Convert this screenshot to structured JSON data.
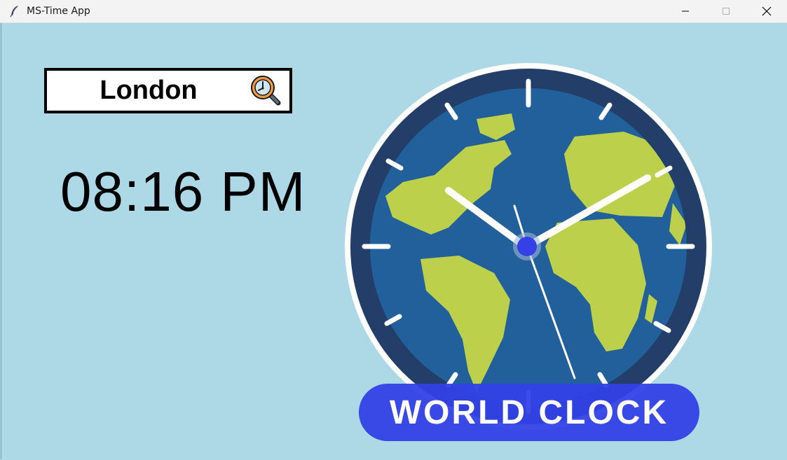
{
  "window": {
    "title": "MS-Time App",
    "controls": {
      "minimize": "minimize-icon",
      "maximize": "maximize-icon",
      "close": "close-icon"
    }
  },
  "search": {
    "value": "London",
    "button_icon": "clock-search-icon"
  },
  "time": {
    "display": "08:16 PM"
  },
  "clock_image": {
    "banner_text": "WORLD CLOCK",
    "colors": {
      "ocean": "#21609a",
      "land": "#bcd04c",
      "rim": "#233e68",
      "banner": "#3341e6"
    }
  },
  "colors": {
    "background": "#add8e6"
  }
}
